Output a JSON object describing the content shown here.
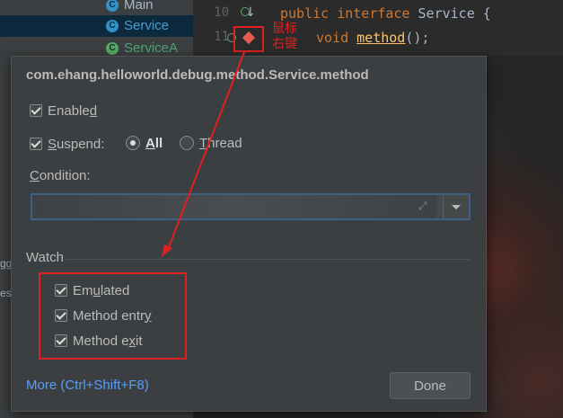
{
  "project_tree": {
    "items": [
      {
        "label": "Main",
        "icon": "C"
      },
      {
        "label": "Service",
        "icon": "C"
      },
      {
        "label": "ServiceA",
        "icon": "C"
      }
    ]
  },
  "editor": {
    "lines": [
      {
        "num": "10",
        "keyword": "public interface",
        "rest": " Service {"
      },
      {
        "num": "11",
        "keyword": "void",
        "method": "method",
        "rest": "();"
      }
    ]
  },
  "annotation": {
    "text": "鼠标\n右键",
    "color": "#e02020"
  },
  "dialog": {
    "title": "com.ehang.helloworld.debug.method.Service.method",
    "enabled": {
      "label_pre": "Enable",
      "label_u": "d",
      "checked": true
    },
    "suspend": {
      "label_u": "S",
      "label_post": "uspend:",
      "checked": true
    },
    "suspend_all": {
      "label_u": "A",
      "label_post": "ll",
      "selected": true
    },
    "suspend_thread": {
      "label_u": "T",
      "label_post": "hread",
      "selected": false
    },
    "condition": {
      "label_u": "C",
      "label_post": "ondition:",
      "value": "",
      "placeholder": ""
    },
    "watch": {
      "label": "Watch",
      "items": [
        {
          "label_pre": "Em",
          "label_u": "u",
          "label_post": "lated",
          "checked": true
        },
        {
          "label_pre": "Method entr",
          "label_u": "y",
          "label_post": "",
          "checked": true
        },
        {
          "label_pre": "Method e",
          "label_u": "x",
          "label_post": "it",
          "checked": true
        }
      ]
    },
    "more_link": "More (Ctrl+Shift+F8)",
    "done_button": "Done"
  },
  "left_strip": [
    "gg",
    "es"
  ],
  "colors": {
    "accent": "#589df6",
    "highlight": "#e02020",
    "dialog_bg": "#3c3f41"
  }
}
